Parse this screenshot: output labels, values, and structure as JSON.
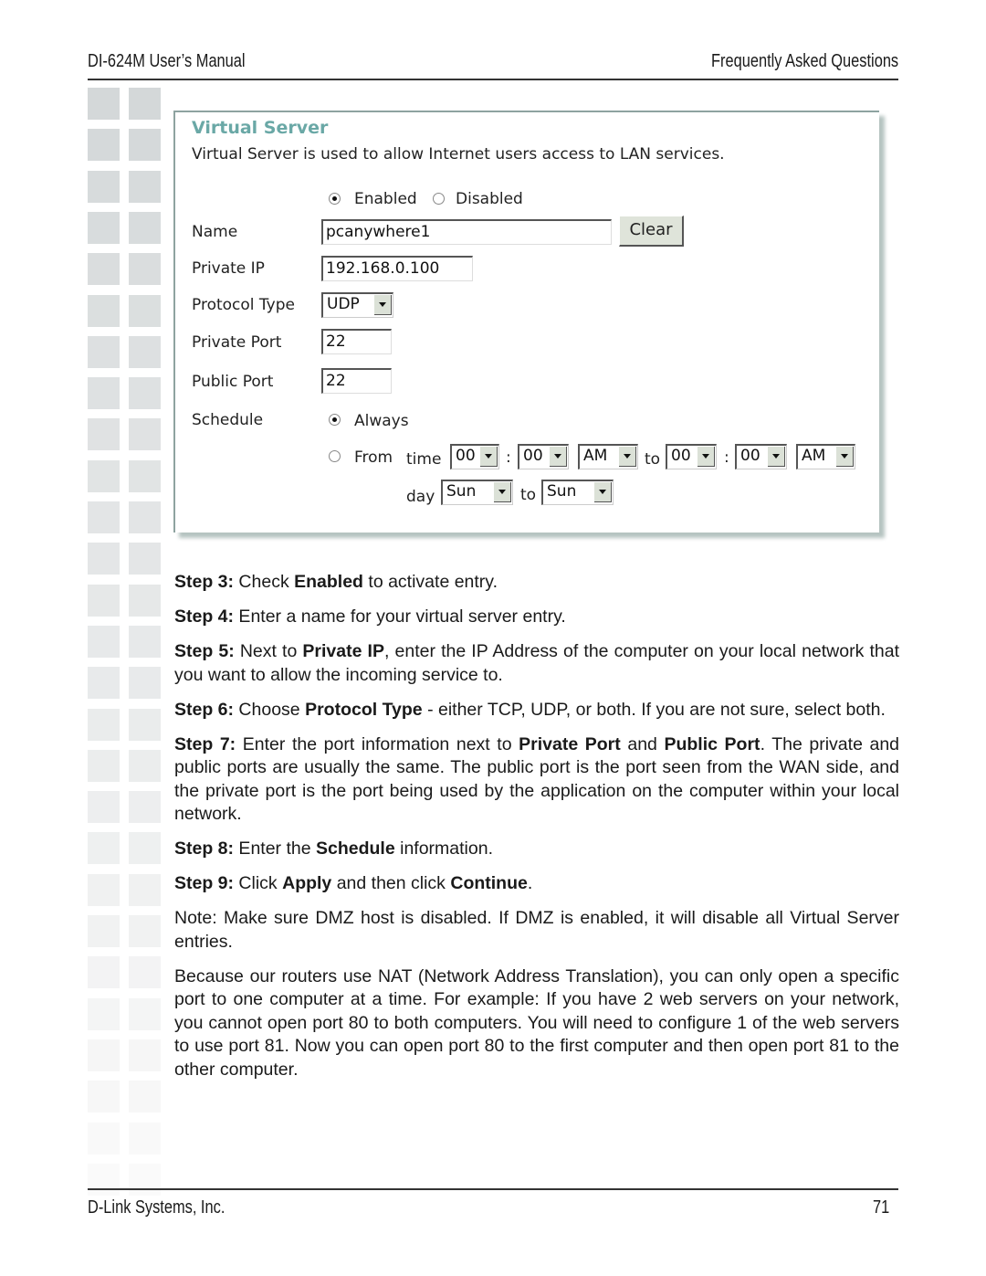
{
  "header": {
    "left": "DI-624M User’s Manual",
    "right": "Frequently Asked Questions"
  },
  "footer": {
    "left": "D-Link Systems, Inc.",
    "right": "71"
  },
  "colors": {
    "panel_title": "#6aa8a6",
    "panel_border": "#8ea3a0",
    "button_face": "#dfe4da",
    "square_dark": "#d6d9da",
    "square_light": "#f3f4f4"
  },
  "panel": {
    "title": "Virtual Server",
    "description": "Virtual Server is used to allow Internet users access to LAN services.",
    "status": {
      "enabled_label": "Enabled",
      "disabled_label": "Disabled",
      "selected": "Enabled"
    },
    "fields": {
      "name_label": "Name",
      "name_value": "pcanywhere1",
      "clear_button": "Clear",
      "private_ip_label": "Private IP",
      "private_ip_value": "192.168.0.100",
      "protocol_label": "Protocol Type",
      "protocol_value": "UDP",
      "private_port_label": "Private Port",
      "private_port_value": "22",
      "public_port_label": "Public Port",
      "public_port_value": "22",
      "schedule_label": "Schedule"
    },
    "schedule": {
      "always_label": "Always",
      "from_label": "From",
      "selected": "Always",
      "time_label": "time",
      "colon": ":",
      "to_label": "to",
      "day_label": "day",
      "start_hour": "00",
      "start_minute": "00",
      "start_ampm": "AM",
      "end_hour": "00",
      "end_minute": "00",
      "end_ampm": "AM",
      "start_day": "Sun",
      "end_day": "Sun"
    }
  },
  "steps": [
    {
      "label": "Step 3:",
      "parts": [
        " Check ",
        "Enabled",
        " to activate entry."
      ]
    },
    {
      "label": "Step 4:",
      "parts": [
        " Enter a name for your virtual server entry."
      ]
    },
    {
      "label": "Step 5:",
      "parts": [
        " Next to ",
        "Private IP",
        ", enter the IP Address of the computer on your local network that you want to allow the incoming service to."
      ]
    },
    {
      "label": "Step 6:",
      "parts": [
        " Choose ",
        "Protocol Type",
        " - either TCP, UDP, or both. If you are not sure, select both."
      ]
    },
    {
      "label": "Step 7:",
      "parts": [
        " Enter the port information next to ",
        "Private Port",
        " and ",
        "Public Port",
        ". The private and public ports are usually the same. The public port is the port seen from the WAN side, and the private port is the port being used by the application on the computer within your local network."
      ]
    },
    {
      "label": "Step 8:",
      "parts": [
        " Enter the ",
        "Schedule",
        " information."
      ]
    },
    {
      "label": "Step 9:",
      "parts": [
        " Click ",
        "Apply",
        " and then click ",
        "Continue",
        "."
      ]
    }
  ],
  "note": "Note: Make sure DMZ host is disabled. If DMZ is enabled, it will disable all Virtual Server entries.",
  "nat_paragraph": "Because our routers use NAT (Network Address Translation), you can only open a specific port to one computer at a time. For example: If you have 2 web servers on your network, you cannot open port 80 to both computers. You will need to configure 1 of the web servers to use port 81. Now you can open port 80 to the first computer and then open port 81 to the other computer."
}
